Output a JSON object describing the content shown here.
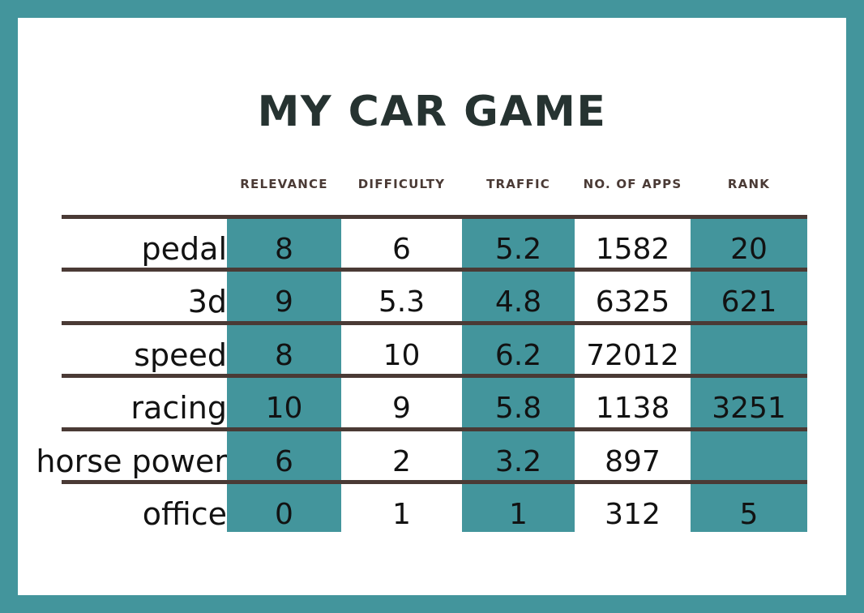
{
  "poster": {
    "title": "MY CAR GAME",
    "frame_color": "#43959c",
    "highlight_color": "#43959c",
    "rule_color": "#4a3a35",
    "title_color": "#263331",
    "header_color": "#4a3a35"
  },
  "chart_data": {
    "type": "table",
    "title": "MY CAR GAME",
    "row_header_label": "",
    "categories": [
      "pedal",
      "3d",
      "speed",
      "racing",
      "horse power",
      "office"
    ],
    "columns": [
      "RELEVANCE",
      "DIFFICULTY",
      "TRAFFIC",
      "NO. OF APPS",
      "RANK"
    ],
    "highlighted_columns": [
      "RELEVANCE",
      "TRAFFIC",
      "RANK"
    ],
    "rows": [
      {
        "label": "pedal",
        "cells": [
          "8",
          "6",
          "5.2",
          "1582",
          "20"
        ]
      },
      {
        "label": "3d",
        "cells": [
          "9",
          "5.3",
          "4.8",
          "6325",
          "621"
        ]
      },
      {
        "label": "speed",
        "cells": [
          "8",
          "10",
          "6.2",
          "72012",
          ""
        ]
      },
      {
        "label": "racing",
        "cells": [
          "10",
          "9",
          "5.8",
          "1138",
          "3251"
        ]
      },
      {
        "label": "horse power",
        "cells": [
          "6",
          "2",
          "3.2",
          "897",
          ""
        ]
      },
      {
        "label": "office",
        "cells": [
          "0",
          "1",
          "1",
          "312",
          "5"
        ]
      }
    ],
    "series": [
      {
        "name": "RELEVANCE",
        "values": [
          8,
          9,
          8,
          10,
          6,
          0
        ]
      },
      {
        "name": "DIFFICULTY",
        "values": [
          6,
          5.3,
          10,
          9,
          2,
          1
        ]
      },
      {
        "name": "TRAFFIC",
        "values": [
          5.2,
          4.8,
          6.2,
          5.8,
          3.2,
          1
        ]
      },
      {
        "name": "NO. OF APPS",
        "values": [
          1582,
          6325,
          72012,
          1138,
          897,
          312
        ]
      },
      {
        "name": "RANK",
        "values": [
          20,
          621,
          null,
          3251,
          null,
          5
        ]
      }
    ],
    "grid": true,
    "legend": "none"
  }
}
